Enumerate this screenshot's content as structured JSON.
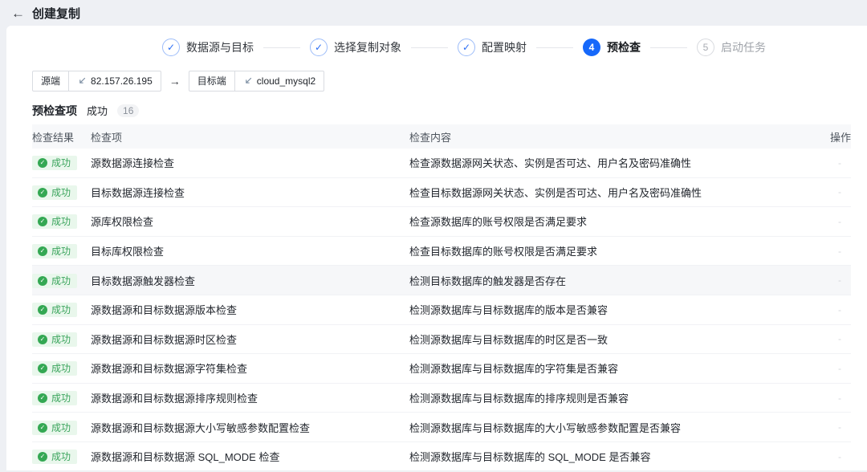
{
  "page": {
    "back_icon": "←",
    "title": "创建复制"
  },
  "stepper": {
    "steps": [
      {
        "label": "数据源与目标",
        "state": "done"
      },
      {
        "label": "选择复制对象",
        "state": "done"
      },
      {
        "label": "配置映射",
        "state": "done"
      },
      {
        "label": "预检查",
        "state": "active",
        "number": "4"
      },
      {
        "label": "启动任务",
        "state": "pending",
        "number": "5"
      }
    ]
  },
  "endpoints": {
    "source_label": "源端",
    "source_value": "82.157.26.195",
    "arrow": "→",
    "target_label": "目标端",
    "target_value": "cloud_mysql2"
  },
  "summary": {
    "title": "预检查项",
    "status_label": "成功",
    "count": "16"
  },
  "table": {
    "headers": [
      "检查结果",
      "检查项",
      "检查内容",
      "操作"
    ],
    "status_label": "成功",
    "action_placeholder": "-",
    "rows": [
      {
        "item": "源数据源连接检查",
        "content": "检查源数据源网关状态、实例是否可达、用户名及密码准确性",
        "highlighted": false
      },
      {
        "item": "目标数据源连接检查",
        "content": "检查目标数据源网关状态、实例是否可达、用户名及密码准确性",
        "highlighted": false
      },
      {
        "item": "源库权限检查",
        "content": "检查源数据库的账号权限是否满足要求",
        "highlighted": false
      },
      {
        "item": "目标库权限检查",
        "content": "检查目标数据库的账号权限是否满足要求",
        "highlighted": false
      },
      {
        "item": "目标数据源触发器检查",
        "content": "检测目标数据库的触发器是否存在",
        "highlighted": true
      },
      {
        "item": "源数据源和目标数据源版本检查",
        "content": "检测源数据库与目标数据库的版本是否兼容",
        "highlighted": false
      },
      {
        "item": "源数据源和目标数据源时区检查",
        "content": "检测源数据库与目标数据库的时区是否一致",
        "highlighted": false
      },
      {
        "item": "源数据源和目标数据源字符集检查",
        "content": "检测源数据库与目标数据库的字符集是否兼容",
        "highlighted": false
      },
      {
        "item": "源数据源和目标数据源排序规则检查",
        "content": "检测源数据库与目标数据库的排序规则是否兼容",
        "highlighted": false
      },
      {
        "item": "源数据源和目标数据源大小写敏感参数配置检查",
        "content": "检测源数据库与目标数据库的大小写敏感参数配置是否兼容",
        "highlighted": false
      },
      {
        "item": "源数据源和目标数据源 SQL_MODE 检查",
        "content": "检测源数据库与目标数据库的 SQL_MODE 是否兼容",
        "highlighted": false
      }
    ]
  },
  "colors": {
    "accent_blue": "#1668fa",
    "success_green": "#34a853"
  }
}
